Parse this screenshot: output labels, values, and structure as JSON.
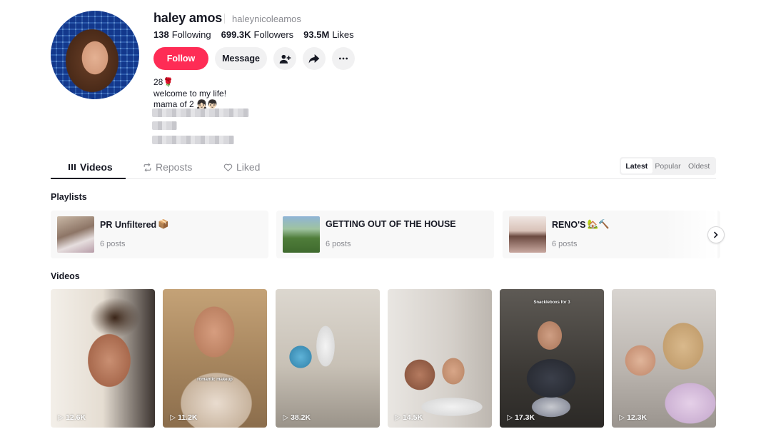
{
  "profile": {
    "display_name": "haley amos",
    "username": "haleynicoleamos",
    "following_count": "138",
    "following_label": "Following",
    "followers_count": "699.3K",
    "followers_label": "Followers",
    "likes_count": "93.5M",
    "likes_label": "Likes",
    "bio_lines": [
      "28🌹",
      "welcome to my life!",
      "mama of 2 👧🏻👦🏻"
    ]
  },
  "actions": {
    "follow_label": "Follow",
    "message_label": "Message"
  },
  "tabs": [
    {
      "label": "Videos",
      "icon": "grid-icon",
      "active": true
    },
    {
      "label": "Reposts",
      "icon": "repost-icon",
      "active": false
    },
    {
      "label": "Liked",
      "icon": "heart-icon",
      "active": false
    }
  ],
  "sort": {
    "options": [
      "Latest",
      "Popular",
      "Oldest"
    ],
    "selected": "Latest"
  },
  "playlists_section": {
    "title": "Playlists",
    "items": [
      {
        "title": "PR Unfiltered",
        "emoji": "📦",
        "count": "6 posts"
      },
      {
        "title": "GETTING OUT OF THE HOUSE",
        "emoji": "",
        "count": "6 posts"
      },
      {
        "title": "RENO'S",
        "emoji": "🏡🔨",
        "count": "6 posts"
      }
    ]
  },
  "videos_section": {
    "title": "Videos",
    "items": [
      {
        "views": "12.6K",
        "caption": ""
      },
      {
        "views": "11.2K",
        "caption": "romantic makeup"
      },
      {
        "views": "38.2K",
        "caption": ""
      },
      {
        "views": "14.5K",
        "caption": ""
      },
      {
        "views": "17.3K",
        "caption": "Snackleboxs for 3"
      },
      {
        "views": "12.3K",
        "caption": ""
      }
    ]
  },
  "colors": {
    "brand": "#fe2c55",
    "text": "#161823",
    "muted": "#8a8b91"
  }
}
